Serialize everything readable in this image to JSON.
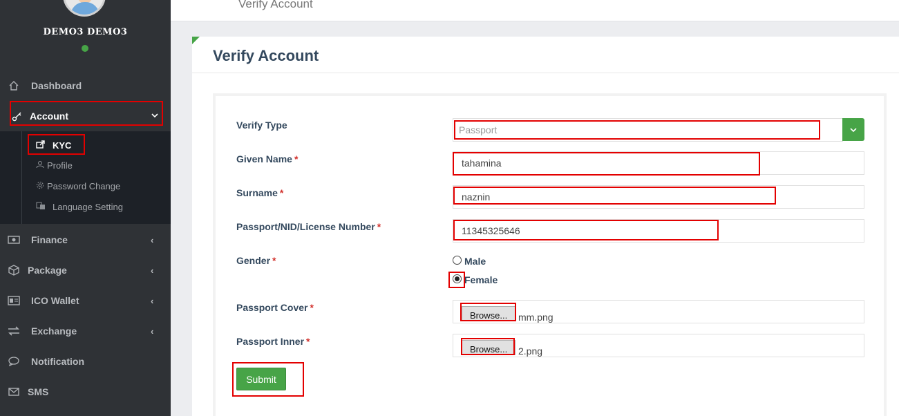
{
  "user": {
    "name": "DEMO3 DEMO3",
    "status_color": "#47a447"
  },
  "header": {
    "breadcrumb": "Verify Account"
  },
  "sidebar": {
    "items": [
      {
        "label": "Dashboard",
        "icon": "home-icon"
      },
      {
        "label": "Account",
        "icon": "key-icon",
        "chevron": "⌄"
      },
      {
        "label": "Finance",
        "icon": "money-icon",
        "chevron": "‹"
      },
      {
        "label": "Package",
        "icon": "cube-icon",
        "chevron": "‹"
      },
      {
        "label": "ICO Wallet",
        "icon": "id-card-icon",
        "chevron": "‹"
      },
      {
        "label": "Exchange",
        "icon": "exchange-icon",
        "chevron": "‹"
      },
      {
        "label": "Notification",
        "icon": "chat-bubble-icon"
      },
      {
        "label": "SMS",
        "icon": "envelope-icon"
      }
    ],
    "submenu": [
      {
        "label": "KYC",
        "icon": "external-link-icon"
      },
      {
        "label": "Profile",
        "icon": "user-icon"
      },
      {
        "label": "Password Change",
        "icon": "gear-icon"
      },
      {
        "label": "Language Setting",
        "icon": "language-icon"
      }
    ]
  },
  "panel": {
    "title": "Verify Account"
  },
  "form": {
    "verify_type": {
      "label": "Verify Type",
      "placeholder": "Passport"
    },
    "given_name": {
      "label": "Given Name",
      "value": "tahamina"
    },
    "surname": {
      "label": "Surname",
      "value": "naznin"
    },
    "id_number": {
      "label": "Passport/NID/License Number",
      "value": "11345325646"
    },
    "gender": {
      "label": "Gender",
      "options": [
        "Male",
        "Female"
      ],
      "selected": "Female"
    },
    "passport_cover": {
      "label": "Passport Cover",
      "button": "Browse...",
      "file": "mm.png"
    },
    "passport_inner": {
      "label": "Passport Inner",
      "button": "Browse...",
      "file": "2.png"
    },
    "required_mark": "*",
    "submit_label": "Submit"
  },
  "colors": {
    "accent": "#47a447",
    "highlight": "#e30000",
    "sidebar_bg": "#2f3236"
  }
}
